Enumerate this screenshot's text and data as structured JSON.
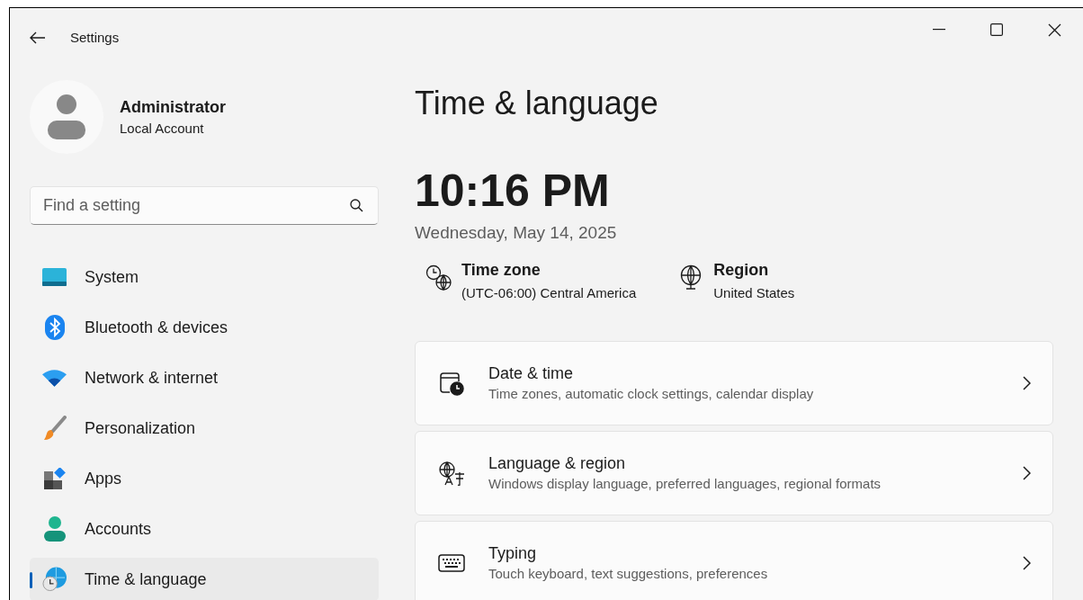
{
  "window": {
    "title": "Settings"
  },
  "account": {
    "name": "Administrator",
    "type": "Local Account"
  },
  "search": {
    "placeholder": "Find a setting"
  },
  "sidebar": {
    "items": [
      {
        "label": "System",
        "kind": "system",
        "selected": false
      },
      {
        "label": "Bluetooth & devices",
        "kind": "bluetooth",
        "selected": false
      },
      {
        "label": "Network & internet",
        "kind": "network",
        "selected": false
      },
      {
        "label": "Personalization",
        "kind": "personalization",
        "selected": false
      },
      {
        "label": "Apps",
        "kind": "apps",
        "selected": false
      },
      {
        "label": "Accounts",
        "kind": "accounts",
        "selected": false
      },
      {
        "label": "Time & language",
        "kind": "time",
        "selected": true
      }
    ]
  },
  "page_title": "Time & language",
  "clock": {
    "time": "10:16 PM",
    "date": "Wednesday, May 14, 2025"
  },
  "info": [
    {
      "kind": "timezone",
      "label": "Time zone",
      "value": "(UTC-06:00) Central America"
    },
    {
      "kind": "region",
      "label": "Region",
      "value": "United States"
    }
  ],
  "cards": [
    {
      "kind": "calendar",
      "title": "Date & time",
      "description": "Time zones, automatic clock settings, calendar display"
    },
    {
      "kind": "language",
      "title": "Language & region",
      "description": "Windows display language, preferred languages, regional formats"
    },
    {
      "kind": "keyboard",
      "title": "Typing",
      "description": "Touch keyboard, text suggestions, preferences"
    }
  ]
}
